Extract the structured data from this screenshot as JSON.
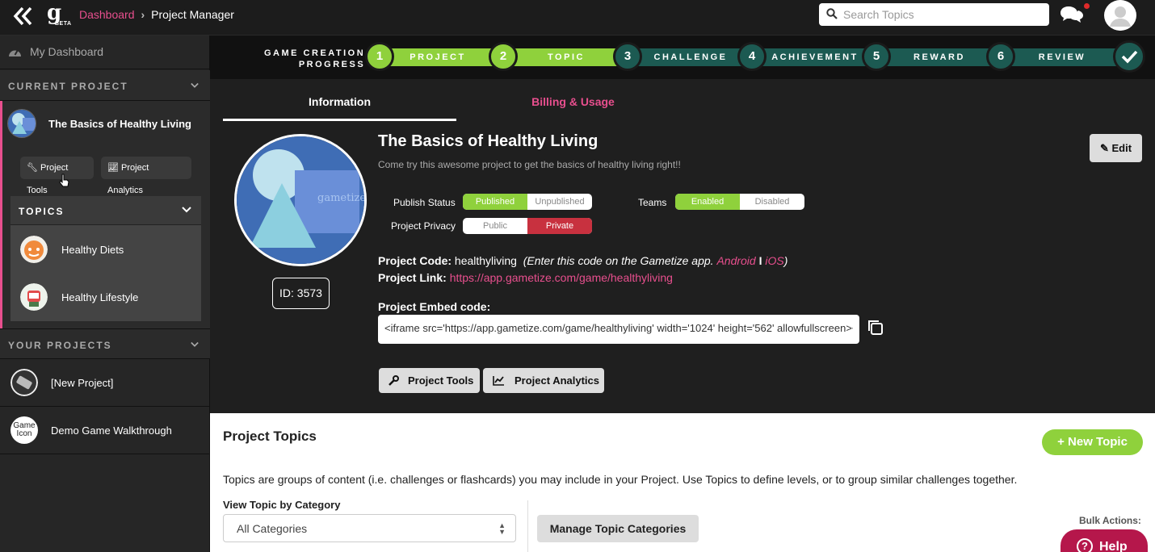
{
  "topbar": {
    "breadcrumb_link": "Dashboard",
    "breadcrumb_current": "Project Manager",
    "logo_letter": "g",
    "logo_badge": "BETA",
    "search_placeholder": "Search Topics"
  },
  "sidebar": {
    "dashboard_label": "My Dashboard",
    "current_project_header": "CURRENT PROJECT",
    "current_project_name": "The Basics of Healthy Living",
    "tools_label": "Project Tools",
    "analytics_label": "Project Analytics",
    "topics_header": "TOPICS",
    "topics": [
      {
        "name": "Healthy Diets"
      },
      {
        "name": "Healthy Lifestyle"
      }
    ],
    "your_projects_header": "YOUR PROJECTS",
    "projects": [
      {
        "name": "[New Project]"
      },
      {
        "name": "Demo Game Walkthrough",
        "icon_text": "Game Icon"
      }
    ]
  },
  "progress": {
    "label_line1": "GAME CREATION",
    "label_line2": "PROGRESS",
    "steps": [
      {
        "num": "1",
        "label": "PROJECT"
      },
      {
        "num": "2",
        "label": "TOPIC"
      },
      {
        "num": "3",
        "label": "CHALLENGE"
      },
      {
        "num": "4",
        "label": "ACHIEVEMENT"
      },
      {
        "num": "5",
        "label": "REWARD"
      },
      {
        "num": "6",
        "label": "REVIEW"
      }
    ],
    "colors": {
      "done": "#8fd13c",
      "pending": "#1c5a52"
    }
  },
  "main": {
    "tabs": [
      {
        "label": "Information"
      },
      {
        "label": "Billing & Usage"
      }
    ],
    "project_title": "The Basics of Healthy Living",
    "project_desc": "Come try this awesome project to get the basics of healthy living right!!",
    "logo_text": "gametize",
    "id_label": "ID: 3573",
    "edit_label": "Edit",
    "publish_status_label": "Publish Status",
    "publish_on": "Published",
    "publish_off": "Unpublished",
    "privacy_label": "Project Privacy",
    "privacy_public": "Public",
    "privacy_private": "Private",
    "teams_label": "Teams",
    "teams_on": "Enabled",
    "teams_off": "Disabled",
    "code_key": "Project Code:",
    "code_value": "healthyliving",
    "code_hint_pre": "(Enter this code on the Gametize app.",
    "android": "Android",
    "divider": "I",
    "ios": "iOS",
    "code_hint_post": ")",
    "link_key": "Project Link:",
    "link_value": "https://app.gametize.com/game/healthyliving",
    "embed_label": "Project Embed code:",
    "embed_value": "<iframe src='https://app.gametize.com/game/healthyliving' width='1024' height='562' allowfullscreen></iframe>",
    "tools_btn": "Project Tools",
    "analytics_btn": "Project Analytics"
  },
  "topics_panel": {
    "title": "Project Topics",
    "new_topic": "New Topic",
    "description": "Topics are groups of content (i.e. challenges or flashcards) you may include in your Project. Use Topics to define levels, or to group similar challenges together.",
    "view_label": "View Topic by Category",
    "category_selected": "All Categories",
    "manage_label": "Manage Topic Categories",
    "bulk_label": "Bulk Actions:",
    "help_label": "Help",
    "help_q": "?"
  },
  "colors": {
    "accent": "#e84f8e",
    "green": "#8fd13c",
    "private_red": "#c8313f",
    "help": "#b5174b"
  }
}
